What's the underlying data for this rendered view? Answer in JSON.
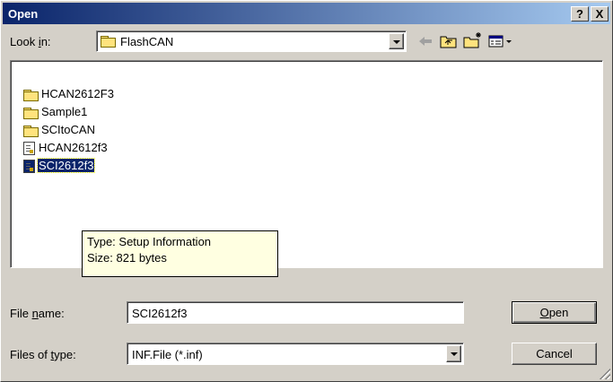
{
  "window": {
    "title": "Open",
    "help_label": "?",
    "close_label": "X"
  },
  "lookin": {
    "label_pre": "Look ",
    "label_access": "i",
    "label_post": "n:",
    "value": "FlashCAN"
  },
  "toolbar_icons": [
    "back-arrow-icon",
    "up-one-level-icon",
    "new-folder-icon",
    "view-menu-icon"
  ],
  "files": [
    {
      "name": "HCAN2612F3",
      "type": "folder"
    },
    {
      "name": "Sample1",
      "type": "folder"
    },
    {
      "name": "SCItoCAN",
      "type": "folder"
    },
    {
      "name": "HCAN2612f3",
      "type": "inf"
    },
    {
      "name": "SCI2612f3",
      "type": "inf",
      "selected": true
    }
  ],
  "tooltip": {
    "line1": "Type: Setup Information",
    "line2": "Size: 821 bytes"
  },
  "filename": {
    "label_pre": "File ",
    "label_access": "n",
    "label_post": "ame:",
    "value": "SCI2612f3"
  },
  "filetype": {
    "label_pre": "Files of ",
    "label_access": "t",
    "label_post": "ype:",
    "value": "INF.File (*.inf)"
  },
  "buttons": {
    "open_access": "O",
    "open_rest": "pen",
    "cancel": "Cancel"
  }
}
